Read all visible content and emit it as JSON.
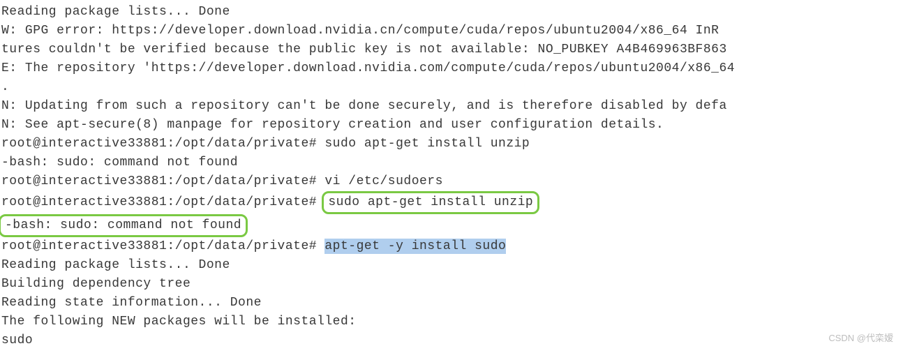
{
  "lines": {
    "l1": "Reading package lists... Done",
    "l2": "W: GPG error: https://developer.download.nvidia.cn/compute/cuda/repos/ubuntu2004/x86_64  InR",
    "l3": "tures couldn't be verified because the public key is not available: NO_PUBKEY A4B469963BF863",
    "l4": "E: The repository 'https://developer.download.nvidia.com/compute/cuda/repos/ubuntu2004/x86_64",
    "l5": ".",
    "l6": "N: Updating from such a repository can't be done securely, and is therefore disabled by defa",
    "l7": "N: See apt-secure(8) manpage for repository creation and user configuration details.",
    "l8_prompt": "root@interactive33881:/opt/data/private# ",
    "l8_cmd": "sudo apt-get install unzip",
    "l9": "-bash: sudo: command not found",
    "l10_prompt": "root@interactive33881:/opt/data/private# ",
    "l10_cmd": "vi /etc/sudoers",
    "l11_prompt": "root@interactive33881:/opt/data/private# ",
    "l11_cmd": "sudo apt-get install unzip",
    "l12": "-bash: sudo: command not found",
    "l13_prompt": "root@interactive33881:/opt/data/private# ",
    "l13_cmd": "apt-get -y install sudo",
    "l14": "Reading package lists... Done",
    "l15": "Building dependency tree",
    "l16": "Reading state information... Done",
    "l17": "The following NEW packages will be installed:",
    "l18": "  sudo"
  },
  "watermark": "CSDN @代栾嫒"
}
